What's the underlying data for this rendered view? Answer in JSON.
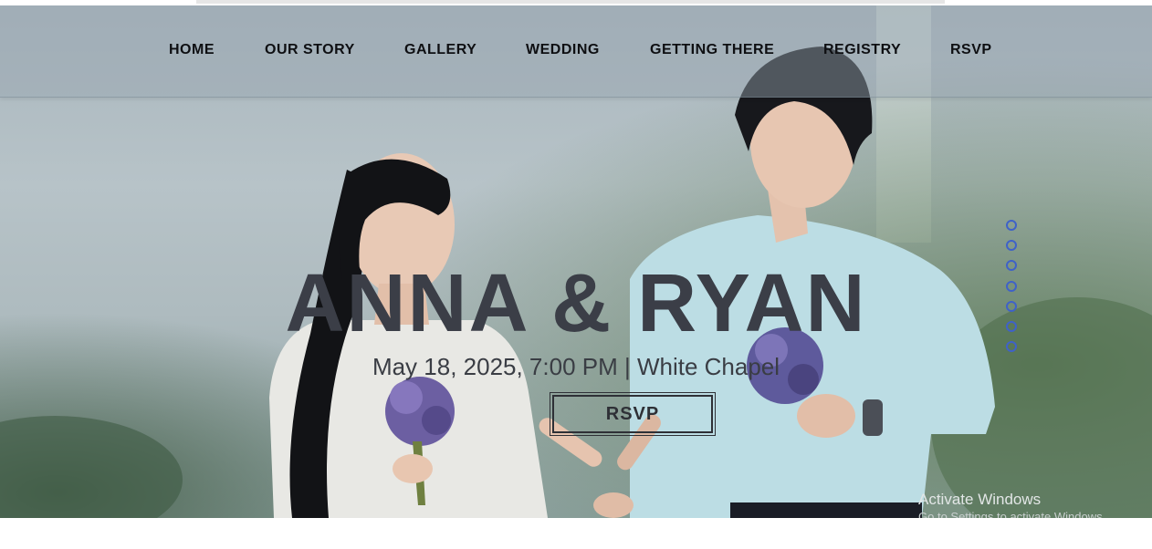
{
  "nav": {
    "items": [
      {
        "label": "HOME"
      },
      {
        "label": "OUR STORY"
      },
      {
        "label": "GALLERY"
      },
      {
        "label": "WEDDING"
      },
      {
        "label": "GETTING THERE"
      },
      {
        "label": "REGISTRY"
      },
      {
        "label": "RSVP"
      }
    ]
  },
  "hero": {
    "title": "ANNA & RYAN",
    "subtitle": "May 18, 2025, 7:00 PM | White Chapel",
    "button_label": "RSVP",
    "slide_count": 7,
    "colors": {
      "title": "#3b3e47",
      "dot_outline": "#3f62c8",
      "nav_text": "#0e0f12"
    }
  },
  "watermark": {
    "line1": "Activate Windows",
    "line2": "Go to Settings to activate Windows."
  }
}
